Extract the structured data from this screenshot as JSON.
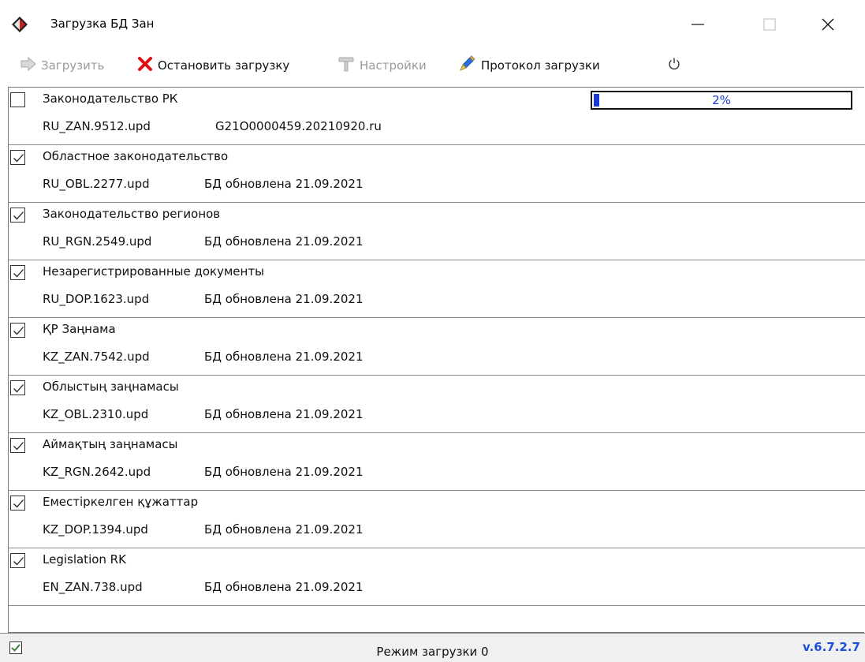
{
  "window": {
    "title": "Загрузка БД Зан",
    "icon": "zan-app-icon",
    "controls": [
      "minimize-icon",
      "maximize-icon",
      "close-icon"
    ]
  },
  "toolbar": {
    "load_label": "Загрузить",
    "stop_label": "Остановить загрузку",
    "settings_label": "Настройки",
    "log_label": "Протокол загрузки",
    "load_disabled": true,
    "settings_disabled": true
  },
  "progress": {
    "item_index": 0,
    "value": 0.02,
    "label": "2%"
  },
  "items": [
    {
      "title": "Законодательство РК",
      "file": "RU_ZAN.9512.upd",
      "status": "G21O0000459.20210920.ru",
      "checked": false
    },
    {
      "title": "Областное законодательство",
      "file": "RU_OBL.2277.upd",
      "status": "БД обновлена 21.09.2021",
      "checked": true
    },
    {
      "title": "Законодательство регионов",
      "file": "RU_RGN.2549.upd",
      "status": "БД обновлена 21.09.2021",
      "checked": true
    },
    {
      "title": "Незарегистрированные документы",
      "file": "RU_DOP.1623.upd",
      "status": "БД обновлена 21.09.2021",
      "checked": true
    },
    {
      "title": "ҚР Заңнама",
      "file": "KZ_ZAN.7542.upd",
      "status": "БД обновлена 21.09.2021",
      "checked": true
    },
    {
      "title": "Облыстың заңнамасы",
      "file": "KZ_OBL.2310.upd",
      "status": "БД обновлена 21.09.2021",
      "checked": true
    },
    {
      "title": "Аймақтың заңнамасы",
      "file": "KZ_RGN.2642.upd",
      "status": "БД обновлена 21.09.2021",
      "checked": true
    },
    {
      "title": "Еместіркелген құжаттар",
      "file": "KZ_DOP.1394.upd",
      "status": "БД обновлена 21.09.2021",
      "checked": true
    },
    {
      "title": "Legislation RK",
      "file": "EN_ZAN.738.upd",
      "status": "БД обновлена 21.09.2021",
      "checked": true
    }
  ],
  "statusbar": {
    "checked": true,
    "mode": "Режим загрузки 0",
    "version": "v.6.7.2.7"
  },
  "colors": {
    "accent": "#1e4fd8",
    "progress": "#1a3ad8",
    "stop": "#e01010"
  }
}
